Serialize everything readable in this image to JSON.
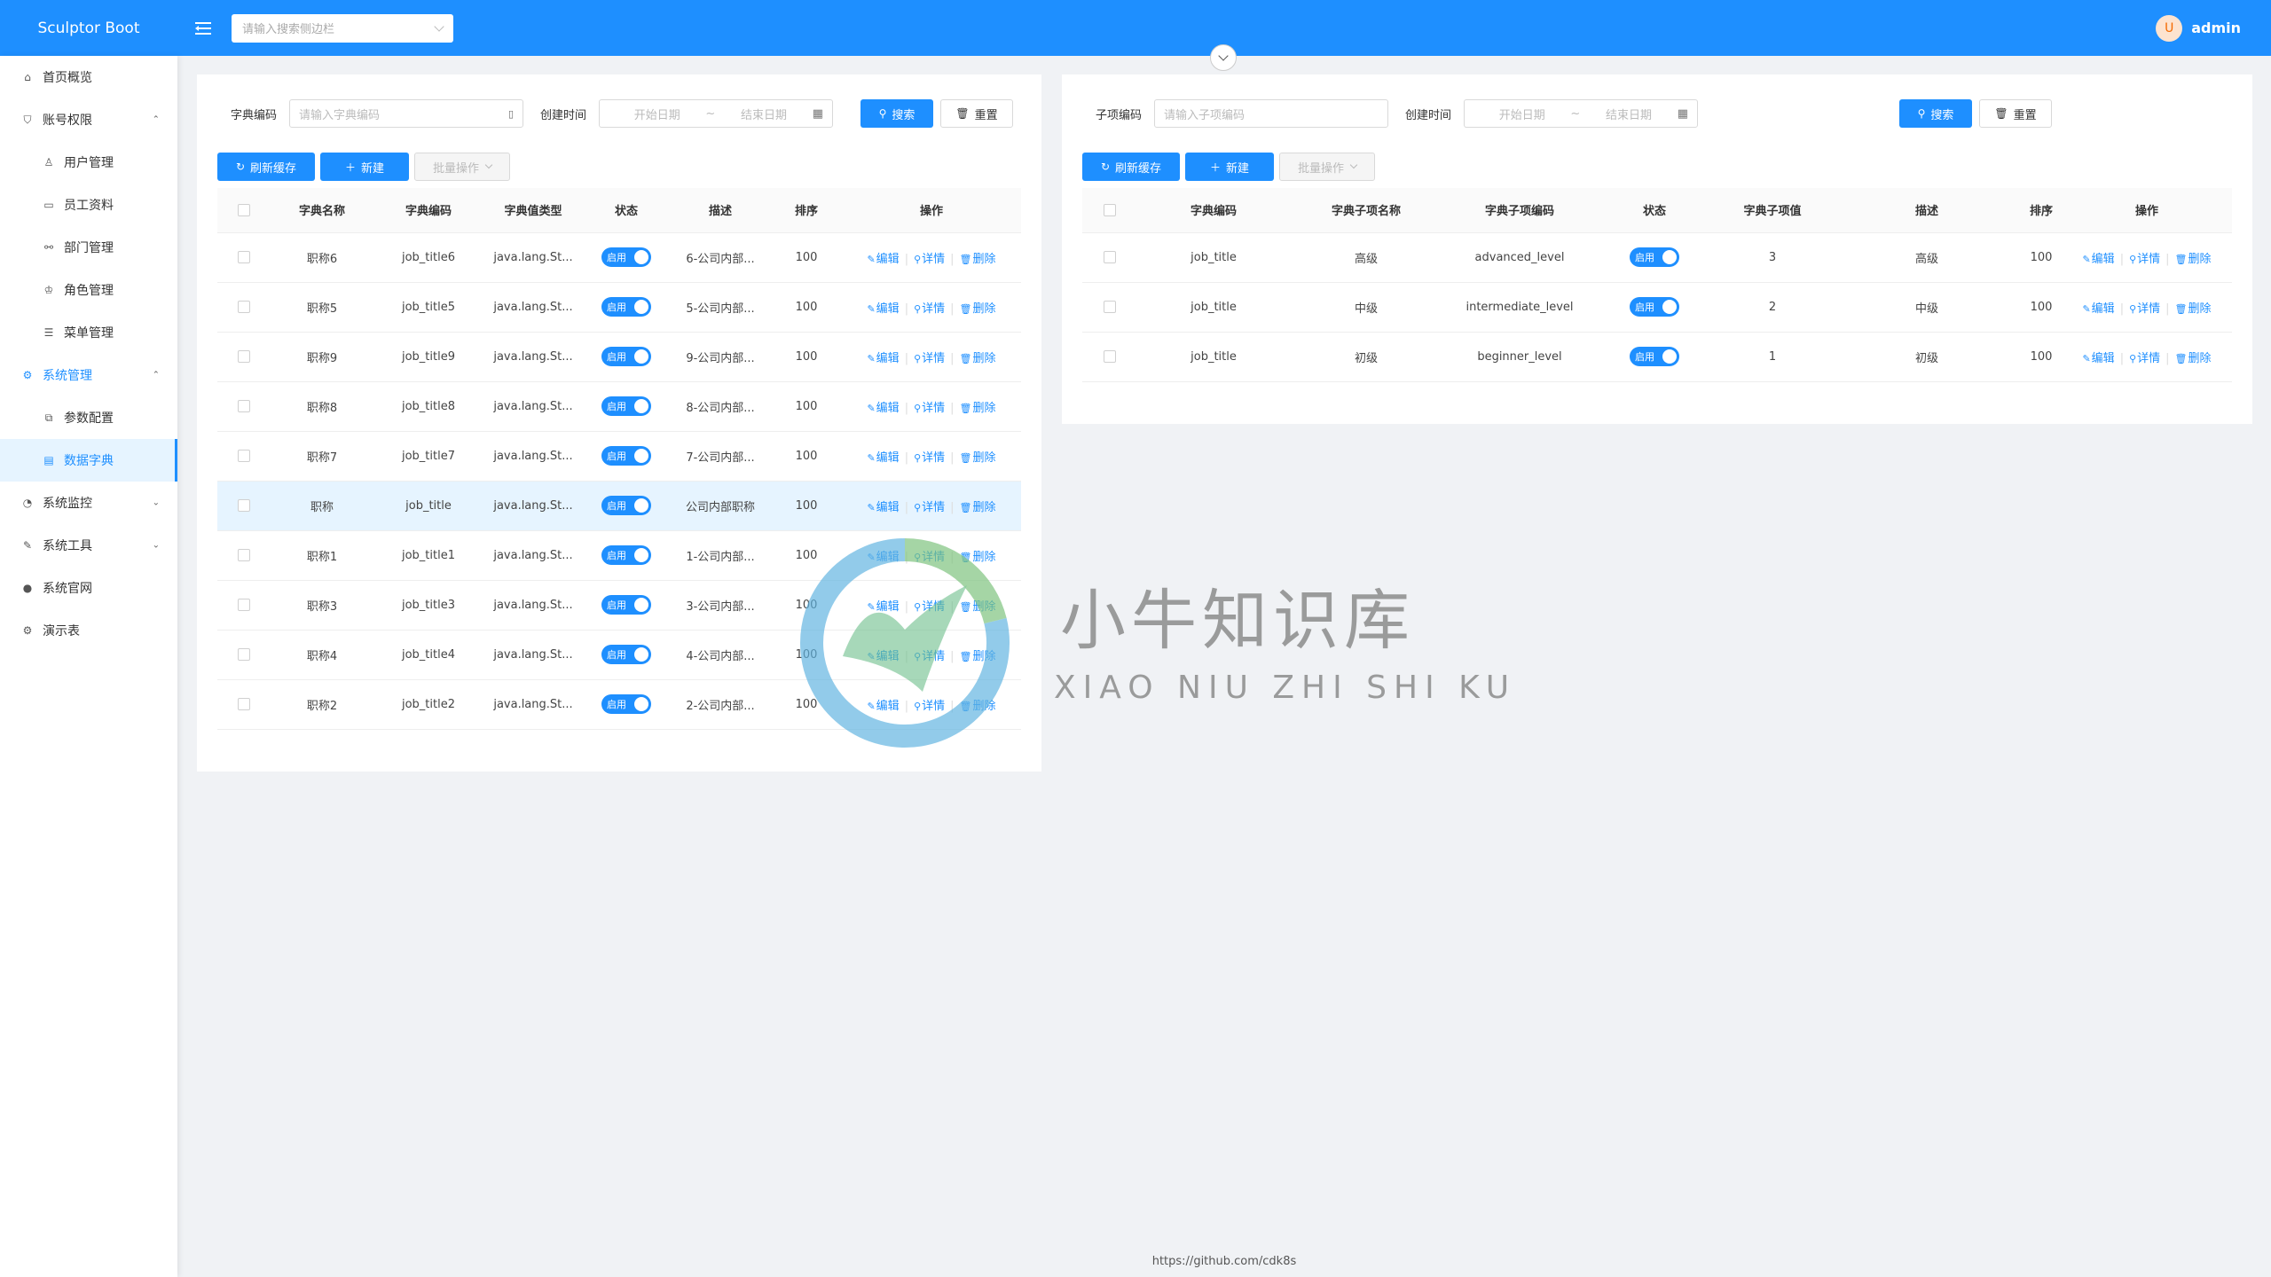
{
  "app": {
    "title": "Sculptor Boot"
  },
  "header": {
    "search_placeholder": "请输入搜索侧边栏",
    "user": "admin",
    "avatar_letter": "U"
  },
  "sidebar": {
    "items": [
      {
        "label": "首页概览",
        "icon": "home-icon"
      },
      {
        "label": "账号权限",
        "icon": "shield-icon",
        "caret": "⌃"
      },
      {
        "label": "用户管理",
        "icon": "user-icon",
        "sub": true
      },
      {
        "label": "员工资料",
        "icon": "id-card-icon",
        "sub": true
      },
      {
        "label": "部门管理",
        "icon": "cluster-icon",
        "sub": true
      },
      {
        "label": "角色管理",
        "icon": "crown-icon",
        "sub": true
      },
      {
        "label": "菜单管理",
        "icon": "menu-icon",
        "sub": true
      },
      {
        "label": "系统管理",
        "icon": "settings-icon",
        "caret": "⌃",
        "open": true
      },
      {
        "label": "参数配置",
        "icon": "config-icon",
        "sub": true
      },
      {
        "label": "数据字典",
        "icon": "book-icon",
        "sub": true,
        "active": true
      },
      {
        "label": "系统监控",
        "icon": "dashboard-icon",
        "caret": "⌄"
      },
      {
        "label": "系统工具",
        "icon": "tool-icon",
        "caret": "⌄"
      },
      {
        "label": "系统官网",
        "icon": "github-icon"
      },
      {
        "label": "演示表",
        "icon": "gear-icon"
      }
    ]
  },
  "left": {
    "filter": {
      "code_label": "字典编码",
      "code_placeholder": "请输入字典编码",
      "time_label": "创建时间",
      "start_placeholder": "开始日期",
      "tilde": "~",
      "end_placeholder": "结束日期",
      "search": "搜索",
      "reset": "重置"
    },
    "toolbar": {
      "refresh": "刷新缓存",
      "create": "新建",
      "batch": "批量操作"
    },
    "columns": [
      "字典名称",
      "字典编码",
      "字典值类型",
      "状态",
      "描述",
      "排序",
      "操作"
    ],
    "rows": [
      {
        "name": "职称6",
        "code": "job_title6",
        "type": "java.lang.St...",
        "status": "启用",
        "desc": "6-公司内部...",
        "sort": "100"
      },
      {
        "name": "职称5",
        "code": "job_title5",
        "type": "java.lang.St...",
        "status": "启用",
        "desc": "5-公司内部...",
        "sort": "100"
      },
      {
        "name": "职称9",
        "code": "job_title9",
        "type": "java.lang.St...",
        "status": "启用",
        "desc": "9-公司内部...",
        "sort": "100"
      },
      {
        "name": "职称8",
        "code": "job_title8",
        "type": "java.lang.St...",
        "status": "启用",
        "desc": "8-公司内部...",
        "sort": "100"
      },
      {
        "name": "职称7",
        "code": "job_title7",
        "type": "java.lang.St...",
        "status": "启用",
        "desc": "7-公司内部...",
        "sort": "100"
      },
      {
        "name": "职称",
        "code": "job_title",
        "type": "java.lang.St...",
        "status": "启用",
        "desc": "公司内部职称",
        "sort": "100",
        "highlight": true
      },
      {
        "name": "职称1",
        "code": "job_title1",
        "type": "java.lang.St...",
        "status": "启用",
        "desc": "1-公司内部...",
        "sort": "100"
      },
      {
        "name": "职称3",
        "code": "job_title3",
        "type": "java.lang.St...",
        "status": "启用",
        "desc": "3-公司内部...",
        "sort": "100"
      },
      {
        "name": "职称4",
        "code": "job_title4",
        "type": "java.lang.St...",
        "status": "启用",
        "desc": "4-公司内部...",
        "sort": "100"
      },
      {
        "name": "职称2",
        "code": "job_title2",
        "type": "java.lang.St...",
        "status": "启用",
        "desc": "2-公司内部...",
        "sort": "100"
      }
    ]
  },
  "right": {
    "filter": {
      "code_label": "子项编码",
      "code_placeholder": "请输入子项编码",
      "time_label": "创建时间",
      "start_placeholder": "开始日期",
      "tilde": "~",
      "end_placeholder": "结束日期",
      "search": "搜索",
      "reset": "重置"
    },
    "toolbar": {
      "refresh": "刷新缓存",
      "create": "新建",
      "batch": "批量操作"
    },
    "columns": [
      "字典编码",
      "字典子项名称",
      "字典子项编码",
      "状态",
      "字典子项值",
      "描述",
      "排序",
      "操作"
    ],
    "rows": [
      {
        "code": "job_title",
        "name": "高级",
        "item_code": "advanced_level",
        "status": "启用",
        "value": "3",
        "desc": "高级",
        "sort": "100"
      },
      {
        "code": "job_title",
        "name": "中级",
        "item_code": "intermediate_level",
        "status": "启用",
        "value": "2",
        "desc": "中级",
        "sort": "100"
      },
      {
        "code": "job_title",
        "name": "初级",
        "item_code": "beginner_level",
        "status": "启用",
        "value": "1",
        "desc": "初级",
        "sort": "100"
      }
    ]
  },
  "ops": {
    "edit": "编辑",
    "detail": "详情",
    "delete": "删除"
  },
  "footer": {
    "link": "https://github.com/cdk8s"
  },
  "watermark": {
    "title": "小牛知识库",
    "subtitle": "XIAO NIU ZHI SHI KU"
  },
  "colors": {
    "primary": "#1e8fff",
    "highlight_row": "#e6f4ff"
  }
}
